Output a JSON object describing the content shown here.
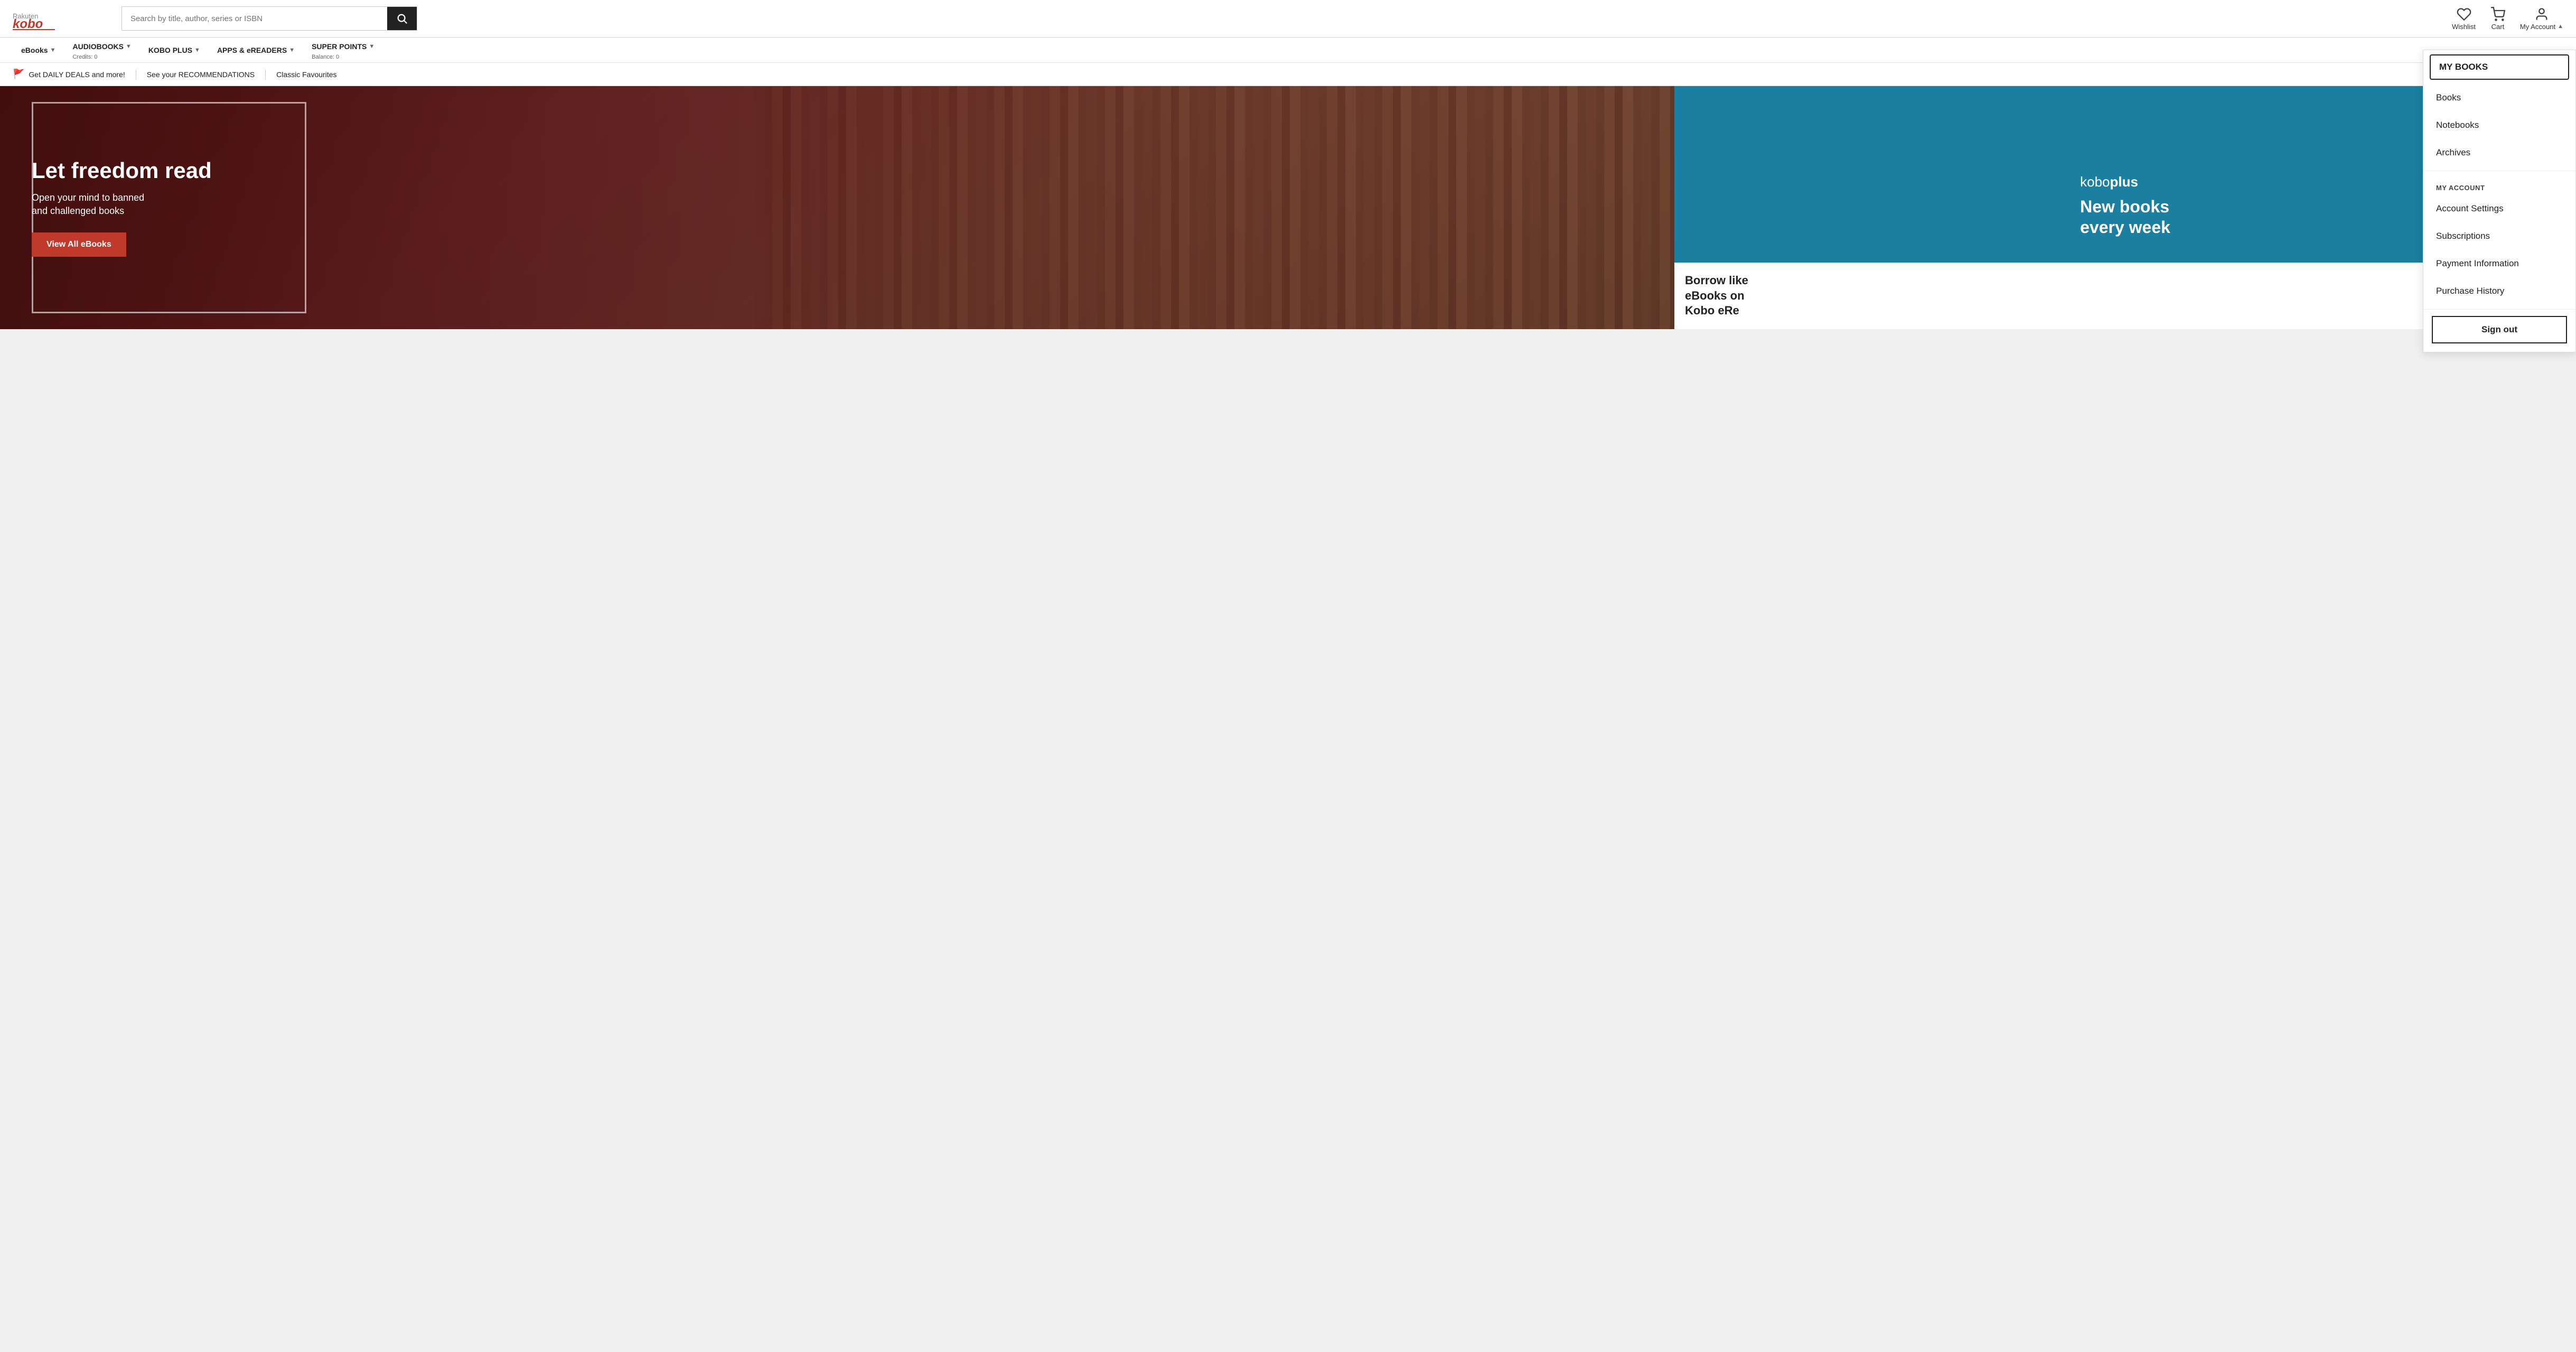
{
  "logo": {
    "text": "Rakuten kobo"
  },
  "search": {
    "placeholder": "Search by title, author, series or ISBN"
  },
  "header_actions": {
    "wishlist": "Wishlist",
    "cart": "Cart",
    "my_account": "My Account"
  },
  "nav": {
    "items": [
      {
        "label": "eBOOKS",
        "sub": ""
      },
      {
        "label": "AUDIOBOOKS",
        "sub": "Credits: 0"
      },
      {
        "label": "KOBO PLUS",
        "sub": ""
      },
      {
        "label": "APPS & eREADERS",
        "sub": ""
      },
      {
        "label": "SUPER POINTS",
        "sub": "Balance: 0"
      }
    ]
  },
  "promo_bar": {
    "items": [
      {
        "label": "Get DAILY DEALS and more!",
        "icon": "flag"
      },
      {
        "label": "See your RECOMMENDATIONS"
      },
      {
        "label": "Classic Favourites"
      }
    ]
  },
  "hero": {
    "title": "Let freedom read",
    "subtitle": "Open your mind to banned\nand challenged books",
    "cta": "View All eBooks"
  },
  "kobo_plus": {
    "logo": "kobo plus",
    "title": "New books\nevery week",
    "borrow_text": "Borrow like\neBooks on\nKobo eRe"
  },
  "dropdown": {
    "my_books_label": "MY BOOKS",
    "items_my_books": [
      {
        "label": "Books",
        "key": "books"
      },
      {
        "label": "Notebooks",
        "key": "notebooks"
      },
      {
        "label": "Archives",
        "key": "archives"
      }
    ],
    "my_account_label": "MY ACCOUNT",
    "items_my_account": [
      {
        "label": "Account Settings",
        "key": "account-settings"
      },
      {
        "label": "Subscriptions",
        "key": "subscriptions"
      },
      {
        "label": "Payment Information",
        "key": "payment-information"
      },
      {
        "label": "Purchase History",
        "key": "purchase-history"
      }
    ],
    "sign_out": "Sign out",
    "active_item": "MY BOOKS"
  }
}
